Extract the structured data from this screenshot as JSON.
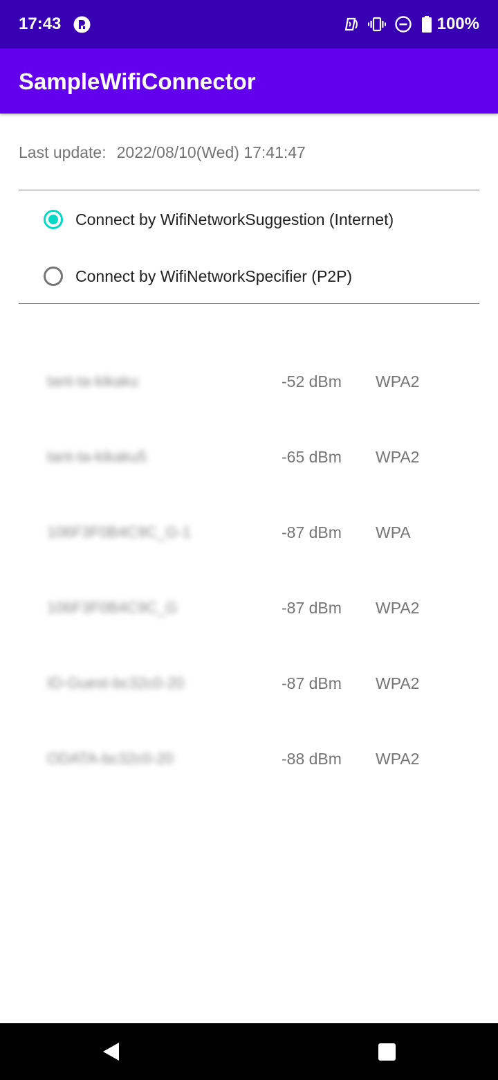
{
  "status_bar": {
    "time": "17:43",
    "left_icon": "app-notification-icon",
    "right_icons": [
      "nfc-icon",
      "vibrate-icon",
      "do-not-disturb-icon",
      "battery-icon"
    ],
    "battery": "100%",
    "background_color": "#3700b3"
  },
  "app_bar": {
    "title": "SampleWifiConnector",
    "background_color": "#6200ee"
  },
  "last_update": {
    "label": "Last update:",
    "value": "2022/08/10(Wed) 17:41:47"
  },
  "connection_options": [
    {
      "label": "Connect by WifiNetworkSuggestion (Internet)",
      "selected": true
    },
    {
      "label": "Connect by WifiNetworkSpecifier (P2P)",
      "selected": false
    }
  ],
  "accent_color": "#03dac5",
  "networks": [
    {
      "ssid": "tant-ta-kikaku",
      "signal": "-52 dBm",
      "security": "WPA2"
    },
    {
      "ssid": "tant-ta-kikaku5",
      "signal": "-65 dBm",
      "security": "WPA2"
    },
    {
      "ssid": "106F3F0B4C9C_G-1",
      "signal": "-87 dBm",
      "security": "WPA"
    },
    {
      "ssid": "106F3F0B4C9C_G",
      "signal": "-87 dBm",
      "security": "WPA2"
    },
    {
      "ssid": "ID-Guest-bc32c0-20",
      "signal": "-87 dBm",
      "security": "WPA2"
    },
    {
      "ssid": "ODATA-bc32c0-20",
      "signal": "-88 dBm",
      "security": "WPA2"
    }
  ],
  "nav_bar": {
    "icons": [
      "back-icon",
      "recent-apps-icon"
    ]
  }
}
